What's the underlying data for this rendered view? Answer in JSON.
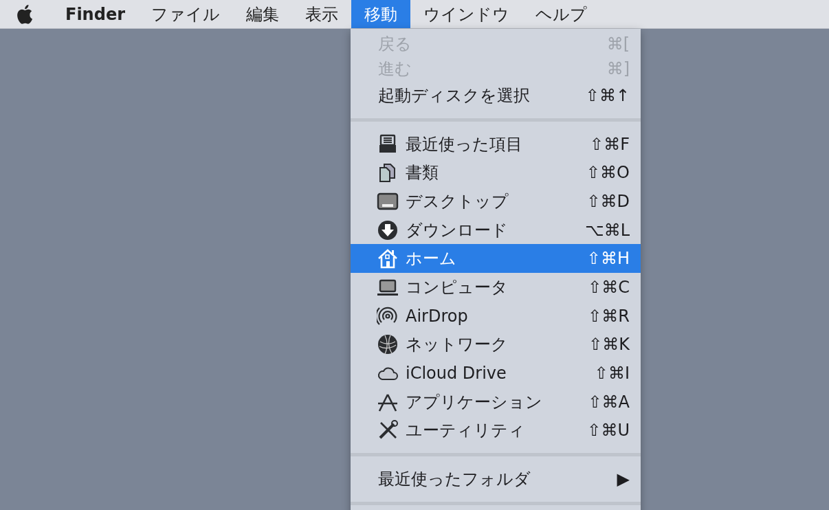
{
  "menubar": [
    {
      "label": "Finder",
      "kind": "app",
      "selected": false
    },
    {
      "label": "ファイル",
      "kind": "menu",
      "selected": false
    },
    {
      "label": "編集",
      "kind": "menu",
      "selected": false
    },
    {
      "label": "表示",
      "kind": "menu",
      "selected": false
    },
    {
      "label": "移動",
      "kind": "menu",
      "selected": true
    },
    {
      "label": "ウインドウ",
      "kind": "menu",
      "selected": false
    },
    {
      "label": "ヘルプ",
      "kind": "menu",
      "selected": false
    }
  ],
  "menu": {
    "groups": [
      [
        {
          "label": "戻る",
          "shortcut": "⌘[",
          "disabled": true,
          "selected": false
        },
        {
          "label": "進む",
          "shortcut": "⌘]",
          "disabled": true,
          "selected": false
        },
        {
          "label": "起動ディスクを選択",
          "shortcut": "⇧⌘↑",
          "disabled": false,
          "selected": false
        }
      ],
      [
        {
          "label": "最近使った項目",
          "shortcut": "⇧⌘F",
          "kind": "tray",
          "disabled": false,
          "selected": false
        },
        {
          "label": "書類",
          "shortcut": "⇧⌘O",
          "kind": "documents",
          "disabled": false,
          "selected": false
        },
        {
          "label": "デスクトップ",
          "shortcut": "⇧⌘D",
          "kind": "desktop",
          "disabled": false,
          "selected": false
        },
        {
          "label": "ダウンロード",
          "shortcut": "⌥⌘L",
          "kind": "download",
          "disabled": false,
          "selected": false
        },
        {
          "label": "ホーム",
          "shortcut": "⇧⌘H",
          "kind": "house",
          "disabled": false,
          "selected": true
        },
        {
          "label": "コンピュータ",
          "shortcut": "⇧⌘C",
          "kind": "laptop",
          "disabled": false,
          "selected": false
        },
        {
          "label": "AirDrop",
          "shortcut": "⇧⌘R",
          "kind": "airdrop",
          "disabled": false,
          "selected": false
        },
        {
          "label": "ネットワーク",
          "shortcut": "⇧⌘K",
          "kind": "globe",
          "disabled": false,
          "selected": false
        },
        {
          "label": "iCloud Drive",
          "shortcut": "⇧⌘I",
          "kind": "cloud",
          "disabled": false,
          "selected": false
        },
        {
          "label": "アプリケーション",
          "shortcut": "⇧⌘A",
          "kind": "appstore",
          "disabled": false,
          "selected": false
        },
        {
          "label": "ユーティリティ",
          "shortcut": "⇧⌘U",
          "kind": "tools",
          "disabled": false,
          "selected": false
        }
      ],
      [
        {
          "label": "最近使ったフォルダ",
          "submenu": "▶",
          "disabled": false,
          "selected": false
        }
      ]
    ]
  }
}
